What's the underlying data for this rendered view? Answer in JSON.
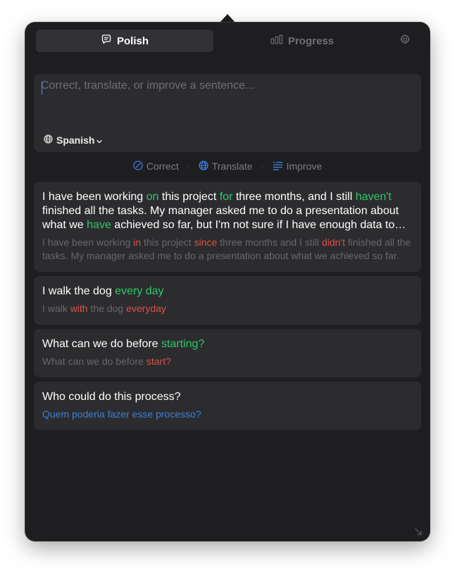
{
  "tabs": {
    "polish": "Polish",
    "progress": "Progress"
  },
  "input": {
    "placeholder": "Correct, translate, or improve a sentence...",
    "language": "Spanish"
  },
  "actions": {
    "correct": "Correct",
    "translate": "Translate",
    "improve": "Improve"
  },
  "colors": {
    "background": "#1e1e21",
    "card": "#2c2c2f",
    "correct_green": "#2fc76a",
    "error_red": "#d9514b",
    "translation_blue": "#3e7fd2",
    "action_icon_blue": "#3d82e6"
  },
  "icons": {
    "polish_tab": "chat-bubble-icon",
    "progress_tab": "bar-chart-icon",
    "settings": "gear-icon",
    "language": "globe-icon",
    "correct": "check-circle-icon",
    "translate": "globe-icon",
    "improve": "sparkle-lines-icon",
    "resize": "resize-arrow-icon"
  },
  "history": [
    {
      "corrected": [
        {
          "t": "I have been working "
        },
        {
          "t": "on",
          "c": "g"
        },
        {
          "t": " this project "
        },
        {
          "t": "for",
          "c": "g"
        },
        {
          "t": " three months, and I still "
        },
        {
          "t": "haven't",
          "c": "g"
        },
        {
          "t": " finished all the tasks. My manager asked me to do a presentation about what we "
        },
        {
          "t": "have",
          "c": "g"
        },
        {
          "t": " achieved so far, but I'm not sure if I have enough data to show."
        }
      ],
      "original": [
        {
          "t": "I have been working "
        },
        {
          "t": "in",
          "c": "r"
        },
        {
          "t": " this project "
        },
        {
          "t": "since",
          "c": "r"
        },
        {
          "t": " three months and I still "
        },
        {
          "t": "didn't",
          "c": "r"
        },
        {
          "t": " finished all the tasks. My manager asked me to do a presentation about what we achieved so far."
        }
      ]
    },
    {
      "corrected": [
        {
          "t": "I walk the dog "
        },
        {
          "t": "every day",
          "c": "g"
        }
      ],
      "original": [
        {
          "t": "I walk "
        },
        {
          "t": "with",
          "c": "r"
        },
        {
          "t": " the dog "
        },
        {
          "t": "everyday",
          "c": "r"
        }
      ]
    },
    {
      "corrected": [
        {
          "t": "What can we do before "
        },
        {
          "t": "starting?",
          "c": "g"
        }
      ],
      "original": [
        {
          "t": "What can we do before "
        },
        {
          "t": "start?",
          "c": "r"
        }
      ]
    },
    {
      "corrected": [
        {
          "t": "Who could do this process?"
        }
      ],
      "original": [
        {
          "t": "Quem poderia fazer esse processo?",
          "c": "b"
        }
      ]
    }
  ]
}
